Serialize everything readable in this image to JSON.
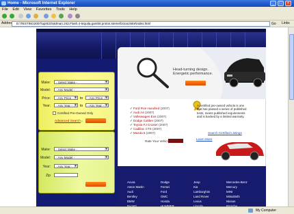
{
  "window": {
    "title": "Home - Microsoft Internet Explorer",
    "menu": [
      "File",
      "Edit",
      "View",
      "Favorites",
      "Tools",
      "Help"
    ],
    "address_label": "Address",
    "address_value": "D:\\TESTING2007\\apr823\\oldman.242.Flash.4-tequila.gambit.protos.siemel\\zoooo\\site\\index.html",
    "go_label": "Go",
    "links_label": "Links",
    "status_zone": "My Computer"
  },
  "search_used": {
    "make_label": "Make:",
    "make_value": "- Select Make -",
    "model_label": "Model:",
    "model_value": "- Any Model -",
    "price_label": "Price:",
    "price_from": "- Any Price -",
    "price_to_label": "to",
    "price_to": "- Any Price -",
    "year_label": "Year:",
    "year_from": "- Any Year -",
    "year_to_label": "to",
    "year_to": "- Any Year -",
    "cpo_label": "Certified Pre-Owned Only",
    "advanced_label": "Advanced Search"
  },
  "search_new": {
    "make_label": "Make:",
    "make_value": "- Select Make -",
    "model_label": "Model:",
    "model_value": "- Any Model -",
    "year_label": "Year:",
    "year_value": "- Any Year -",
    "zip_label": "Zip"
  },
  "hero": {
    "line1": "Head-turning design.",
    "line2": "Energetic performance."
  },
  "rated": {
    "items": [
      {
        "name": "Ford Five Hundred",
        "year": "(2007)"
      },
      {
        "name": "Audi A4",
        "year": "(2007)"
      },
      {
        "name": "Volkswagen Eos",
        "year": "(2007)"
      },
      {
        "name": "Dodge Caliber",
        "year": "(2007)"
      },
      {
        "name": "Toyota FJ Cruiser",
        "year": "(2007)"
      },
      {
        "name": "Cadillac CTS",
        "year": "(2007)"
      },
      {
        "name": "Mazda 6",
        "year": "(2007)"
      }
    ],
    "rate_label": "Rate Your Vehicle"
  },
  "cpo": {
    "text": "A certified pre-owned vehicle is one that has passed a series of published tests, meets published requirements and is backed by a limited warranty.",
    "search_link": "Search Certified Listings",
    "learn_more": "Learn More"
  },
  "brands": [
    [
      "Acura",
      "Aston Martin",
      "Audi",
      "Bentley",
      "BMW",
      "Bugatti"
    ],
    [
      "Dodge",
      "Ferrari",
      "Ford",
      "GMC",
      "Honda",
      "HUMMER"
    ],
    [
      "Jeep",
      "Kia",
      "Lamborghini",
      "Land Rover",
      "Lexus",
      "Lincoln"
    ],
    [
      "Mercedes-Benz",
      "Mercury",
      "MINI",
      "Mitsubishi",
      "Nissan",
      "Porsche"
    ]
  ],
  "colors": {
    "accent_orange": "#e8590c",
    "navy": "#161b6e",
    "yellow": "#fffc8e"
  }
}
